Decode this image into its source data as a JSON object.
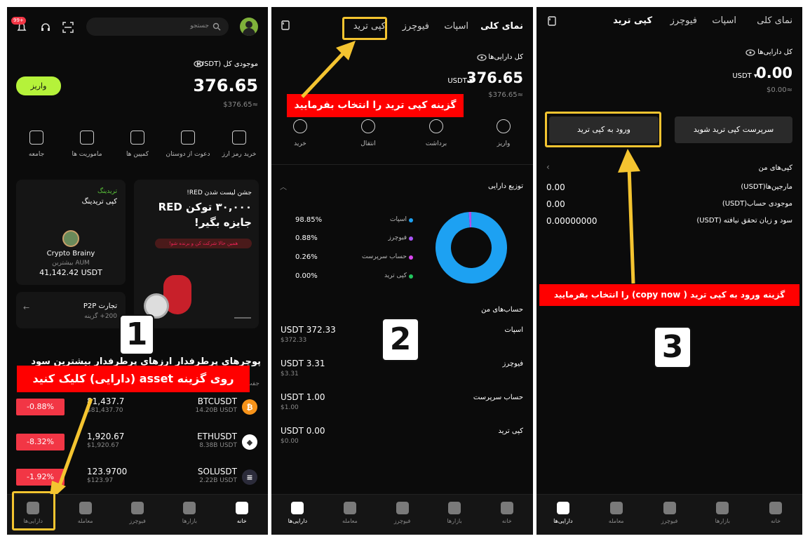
{
  "panel1": {
    "notif_badge": "99+",
    "search_placeholder": "جستجو",
    "balance_label": "موجودی کل (USDT)",
    "balance_value": "376.65",
    "balance_sub": "$376.65≈",
    "deposit_label": "واریز",
    "actions": [
      "خرید رمز ارز",
      "دعوت از دوستان",
      "کمپین ها",
      "ماموریت ها",
      "جامعه"
    ],
    "copy_card": {
      "tag": "تریدینگ",
      "title": "کپی تریدینگ",
      "trader": "Crypto Brainy",
      "aum_label": "بیشترین AUM",
      "aum_value": "41,142.42 USDT"
    },
    "promo": {
      "line1": "جشن لیست شدن RED!",
      "line2": "۳۰,۰۰۰ توکن RED",
      "line3": "جایزه بگیر!",
      "pill": "همین حالا شرکت کن و برنده شو!"
    },
    "p2p": {
      "title": "تجارت P2P",
      "sub": "200+ گزینه"
    },
    "section_tabs": "پوچرهای پرطرفدار    ارزهای پرطرفدار    بیشترین سود",
    "section_sub": "جفت",
    "annotation": "روی گزینه asset (دارایی) کلیک کنید",
    "step": "1",
    "markets": [
      {
        "pair": "BTCUSDT",
        "vol": "14.20B USDT",
        "price": "81,437.7",
        "price_sub": "$81,437.70",
        "change": "-0.88%",
        "icon": "bitcoin-icon",
        "color": "#f7931a",
        "glyph": "₿"
      },
      {
        "pair": "ETHUSDT",
        "vol": "8.38B USDT",
        "price": "1,920.67",
        "price_sub": "$1,920.67",
        "change": "-8.32%",
        "icon": "ethereum-icon",
        "color": "#ffffff",
        "glyph": "◆"
      },
      {
        "pair": "SOLUSDT",
        "vol": "2.22B USDT",
        "price": "123.9700",
        "price_sub": "$123.97",
        "change": "-1.92%",
        "icon": "solana-icon",
        "color": "#2b2b3a",
        "glyph": "≡"
      }
    ],
    "tabs": [
      "خانه",
      "بازارها",
      "فیوچرز",
      "معامله",
      "دارایی‌ها"
    ]
  },
  "panel2": {
    "top_tabs": [
      "نمای کلی",
      "اسپات",
      "فیوچرز",
      "کپی ترید"
    ],
    "assets_label": "کل دارایی‌ها",
    "assets_value": "376.65",
    "assets_unit": "USDT",
    "assets_sub": "$376.65≈",
    "annotation": "گزینه کپی ترید را انتخاب بفرمایید",
    "actions": [
      "واریز",
      "برداشت",
      "انتقال",
      "خرید"
    ],
    "dist_title": "توزیع دارایی",
    "dist": [
      {
        "name": "اسپات",
        "pct": "98.85%",
        "value": 98.85,
        "color": "#1da1f2"
      },
      {
        "name": "فیوچرز",
        "pct": "0.88%",
        "value": 0.88,
        "color": "#a855f7"
      },
      {
        "name": "حساب سرپرست",
        "pct": "0.26%",
        "value": 0.26,
        "color": "#d946ef"
      },
      {
        "name": "کپی ترید",
        "pct": "0.00%",
        "value": 0.0,
        "color": "#22c55e"
      }
    ],
    "accounts_title": "حساب‌های من",
    "accounts": [
      {
        "name": "اسپات",
        "value": "USDT 372.33",
        "sub": "$372.33"
      },
      {
        "name": "فیوچرز",
        "value": "USDT 3.31",
        "sub": "$3.31"
      },
      {
        "name": "حساب سرپرست",
        "value": "USDT 1.00",
        "sub": "$1.00"
      },
      {
        "name": "کپی ترید",
        "value": "USDT 0.00",
        "sub": "$0.00"
      }
    ],
    "step": "2",
    "tabs": [
      "خانه",
      "بازارها",
      "فیوچرز",
      "معامله",
      "دارایی‌ها"
    ]
  },
  "panel3": {
    "top_tabs": [
      "نمای کلی",
      "اسپات",
      "فیوچرز",
      "کپی ترید"
    ],
    "assets_label": "کل دارایی‌ها",
    "assets_value": "0.00",
    "assets_unit": "USDT",
    "assets_sub": "$0.00≈",
    "supervisor_btn": "سرپرست کپی ترید شوید",
    "enter_btn": "ورود به کپی ترید",
    "copies_title": "کپی‌های من",
    "rows": [
      {
        "label": "مارجین‌ها(USDT)",
        "value": "0.00"
      },
      {
        "label": "موجودی حساب(USDT)",
        "value": "0.00"
      },
      {
        "label": "سود و زیان تحقق نیافته (USDT)",
        "value": "0.00000000"
      }
    ],
    "annotation": "گزینه ورود به کپی ترید ( copy now) را انتخاب بفرمایید",
    "step": "3",
    "tabs": [
      "خانه",
      "بازارها",
      "فیوچرز",
      "معامله",
      "دارایی‌ها"
    ]
  }
}
